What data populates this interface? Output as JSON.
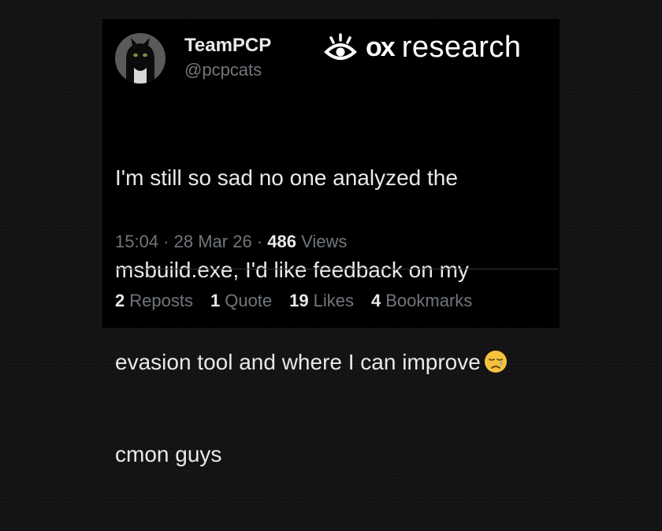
{
  "author": {
    "name": "TeamPCP",
    "handle": "@pcpcats"
  },
  "brand": {
    "icon": "eye-icon",
    "ox": "ox",
    "research": "research"
  },
  "tweet": {
    "lines": [
      "I'm still so sad no one analyzed the",
      "msbuild.exe, I'd like feedback on my",
      "evasion tool and where I can improve",
      "cmon guys"
    ],
    "emoji": "sad-relieved-face-emoji"
  },
  "meta": {
    "time": "15:04",
    "sep1": " · ",
    "date": "28 Mar 26",
    "sep2": " · ",
    "views_count": "486",
    "views_label": "Views"
  },
  "stats": {
    "reposts_count": "2",
    "reposts_label": "Reposts",
    "quotes_count": "1",
    "quotes_label": "Quote",
    "likes_count": "19",
    "likes_label": "Likes",
    "bookmarks_count": "4",
    "bookmarks_label": "Bookmarks"
  },
  "colors": {
    "background": "#121212",
    "card": "#000000",
    "text": "#e7e9ea",
    "muted": "#71767b",
    "emoji": "#f5c23c"
  }
}
